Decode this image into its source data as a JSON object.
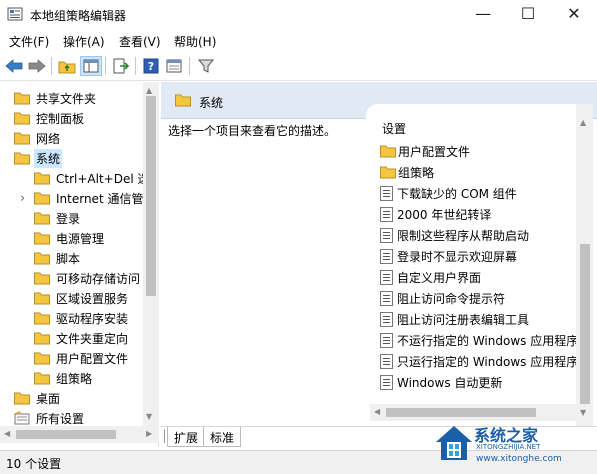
{
  "window": {
    "title": "本地组策略编辑器",
    "minimize": "—",
    "maximize": "☐",
    "close": "✕"
  },
  "menu": {
    "items": [
      {
        "label": "文件(F)"
      },
      {
        "label": "操作(A)"
      },
      {
        "label": "查看(V)"
      },
      {
        "label": "帮助(H)"
      }
    ]
  },
  "toolbar": {
    "buttons": [
      "back-icon",
      "forward-icon",
      "up-folder-icon",
      "show-hide-tree-icon",
      "export-list-icon",
      "help-icon",
      "extended-view-icon",
      "filter-icon"
    ]
  },
  "tree": {
    "items": [
      {
        "label": "共享文件夹",
        "level": 0
      },
      {
        "label": "控制面板",
        "level": 0
      },
      {
        "label": "网络",
        "level": 0
      },
      {
        "label": "系统",
        "level": 0,
        "selected": true
      },
      {
        "label": "Ctrl+Alt+Del 选",
        "level": 1
      },
      {
        "label": "Internet 通信管",
        "level": 1,
        "expandable": true
      },
      {
        "label": "登录",
        "level": 1
      },
      {
        "label": "电源管理",
        "level": 1
      },
      {
        "label": "脚本",
        "level": 1
      },
      {
        "label": "可移动存储访问",
        "level": 1
      },
      {
        "label": "区域设置服务",
        "level": 1
      },
      {
        "label": "驱动程序安装",
        "level": 1
      },
      {
        "label": "文件夹重定向",
        "level": 1
      },
      {
        "label": "用户配置文件",
        "level": 1
      },
      {
        "label": "组策略",
        "level": 1
      },
      {
        "label": "桌面",
        "level": 0
      },
      {
        "label": "所有设置",
        "level": 0,
        "icon": "settings"
      }
    ]
  },
  "right": {
    "header": "系统",
    "description_prompt": "选择一个项目来查看它的描述。",
    "column_header": "设置",
    "items": [
      {
        "label": "用户配置文件",
        "type": "folder"
      },
      {
        "label": "组策略",
        "type": "folder"
      },
      {
        "label": "下载缺少的 COM 组件",
        "type": "policy"
      },
      {
        "label": "2000 年世纪转译",
        "type": "policy"
      },
      {
        "label": "限制这些程序从帮助启动",
        "type": "policy"
      },
      {
        "label": "登录时不显示欢迎屏幕",
        "type": "policy"
      },
      {
        "label": "自定义用户界面",
        "type": "policy"
      },
      {
        "label": "阻止访问命令提示符",
        "type": "policy"
      },
      {
        "label": "阻止访问注册表编辑工具",
        "type": "policy"
      },
      {
        "label": "不运行指定的 Windows 应用程序",
        "type": "policy"
      },
      {
        "label": "只运行指定的 Windows 应用程序",
        "type": "policy"
      },
      {
        "label": "Windows 自动更新",
        "type": "policy"
      }
    ]
  },
  "tabs": [
    {
      "label": "扩展",
      "active": true
    },
    {
      "label": "标准",
      "active": false
    }
  ],
  "status": {
    "text": "10 个设置"
  },
  "watermark": {
    "title": "系统之家",
    "subtitle": "XITONGZHIJIA.NET",
    "url": "www.xitonghe.com"
  },
  "colors": {
    "folder": "#f5c542",
    "header_bg": "#e1eaf4",
    "selection": "#cce8ff",
    "watermark": "#1b5fa8"
  }
}
